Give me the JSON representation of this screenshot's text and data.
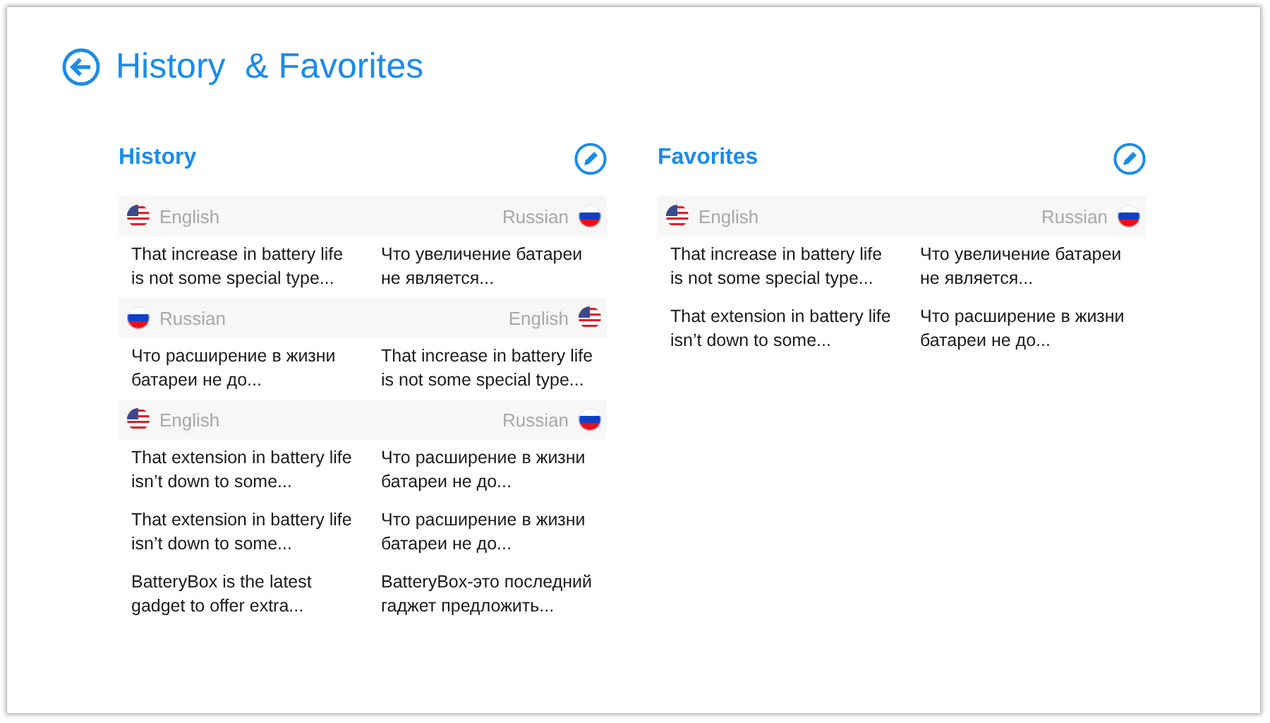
{
  "header": {
    "title": "History  & Favorites"
  },
  "sections": [
    {
      "title": "History",
      "groups": [
        {
          "from": {
            "language": "English",
            "kind": "us"
          },
          "to": {
            "language": "Russian",
            "kind": "ru"
          },
          "entries": [
            {
              "source": "That increase in battery life is not some special type...",
              "target": "Что увеличение батареи не является..."
            }
          ]
        },
        {
          "from": {
            "language": "Russian",
            "kind": "ru"
          },
          "to": {
            "language": "English",
            "kind": "us"
          },
          "entries": [
            {
              "source": "Что расширение в жизни батареи не до...",
              "target": "That increase in battery life is not some special type..."
            }
          ]
        },
        {
          "from": {
            "language": "English",
            "kind": "us"
          },
          "to": {
            "language": "Russian",
            "kind": "ru"
          },
          "entries": [
            {
              "source": "That extension in battery life isn’t down to some...",
              "target": "Что расширение в жизни батареи не до..."
            },
            {
              "source": "That extension in battery life isn’t down to some...",
              "target": "Что расширение в жизни батареи не до..."
            },
            {
              "source": "BatteryBox is the latest gadget to offer extra...",
              "target": "BatteryBox-это последний гаджет предложить..."
            }
          ]
        }
      ]
    },
    {
      "title": "Favorites",
      "groups": [
        {
          "from": {
            "language": "English",
            "kind": "us"
          },
          "to": {
            "language": "Russian",
            "kind": "ru"
          },
          "entries": [
            {
              "source": "That increase in battery life is not some special type...",
              "target": "Что увеличение батареи не является..."
            },
            {
              "source": "That extension in battery life isn’t down to some...",
              "target": "Что расширение в жизни батареи не до..."
            }
          ]
        }
      ]
    }
  ]
}
